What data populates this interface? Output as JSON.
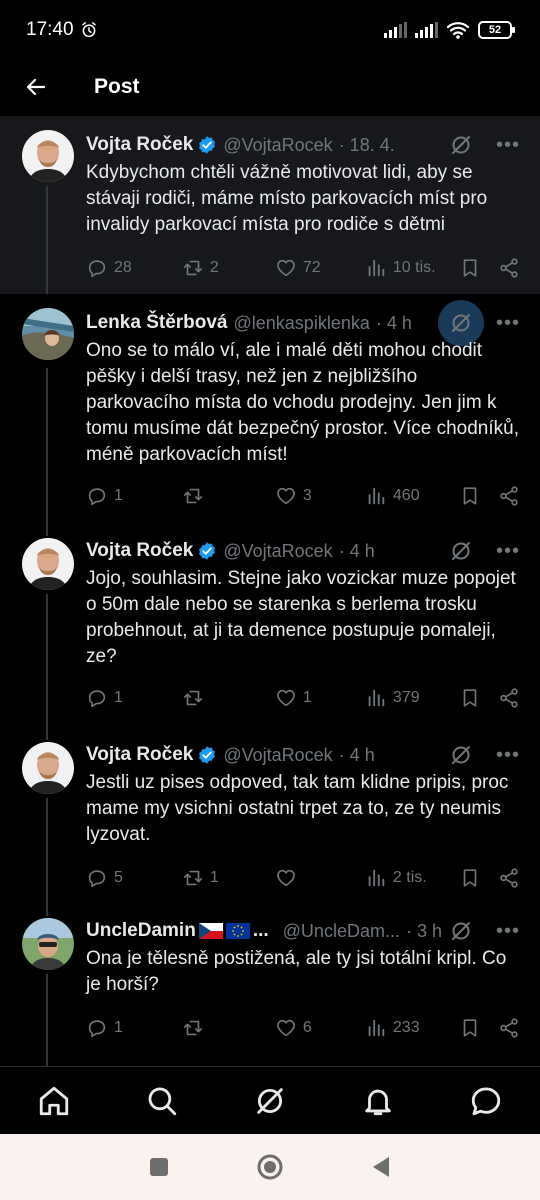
{
  "status_bar": {
    "time": "17:40",
    "battery": "52"
  },
  "header": {
    "title": "Post"
  },
  "posts": [
    {
      "name": "Vojta Roček",
      "handle": "@VojtaRocek",
      "time": "· 18. 4.",
      "text": "Kdybychom chtěli vážně motivovat lidi, aby se stávaji rodiči, máme místo parkovacích míst pro invalidy parkovací místa pro rodiče s dětmi",
      "replies": "28",
      "reposts": "2",
      "likes": "72",
      "views": "10 tis."
    },
    {
      "name": "Lenka Štěrbová",
      "handle": "@lenkaspiklenka",
      "time": "· 4 h",
      "text": "Ono se to málo ví, ale i malé děti mohou chodit pěšky i delší trasy, než jen z nejbližšího parkovacího místa do vchodu prodejny. Jen jim k tomu musíme dát bezpečný prostor. Více chodníků, méně parkovacích míst!",
      "replies": "1",
      "reposts": "",
      "likes": "3",
      "views": "460"
    },
    {
      "name": "Vojta Roček",
      "handle": "@VojtaRocek",
      "time": "· 4 h",
      "text": "Jojo, souhlasim. Stejne jako vozickar muze popojet o 50m dale nebo se starenka s berlema trosku probehnout, at ji ta demence postupuje pomaleji, ze?",
      "replies": "1",
      "reposts": "",
      "likes": "1",
      "views": "379"
    },
    {
      "name": "Vojta Roček",
      "handle": "@VojtaRocek",
      "time": "· 4 h",
      "text": "Jestli uz pises odpoved, tak tam klidne pripis, proc mame my vsichni ostatni trpet za to, ze ty neumis lyzovat.",
      "replies": "5",
      "reposts": "1",
      "likes": "",
      "views": "2 tis."
    },
    {
      "name": "UncleDamin",
      "name_suffix": "...",
      "handle": "@UncleDam...",
      "time": "· 3 h",
      "text": "Ona je tělesně postižená, ale ty jsi totální kripl. Co je horší?",
      "replies": "1",
      "reposts": "",
      "likes": "6",
      "views": "233"
    }
  ],
  "icons": {
    "back": "arrow-left-icon",
    "verified": "verified-badge-icon",
    "grok": "grok-icon",
    "more": "more-dots-icon",
    "reply": "reply-icon",
    "repost": "repost-icon",
    "like": "heart-icon",
    "views": "views-icon",
    "bookmark": "bookmark-icon",
    "share": "share-icon"
  },
  "colors": {
    "background": "#000000",
    "highlight": "#16181c",
    "text": "#e7e9ea",
    "muted": "#71767b",
    "accent": "#1d9bf0"
  }
}
